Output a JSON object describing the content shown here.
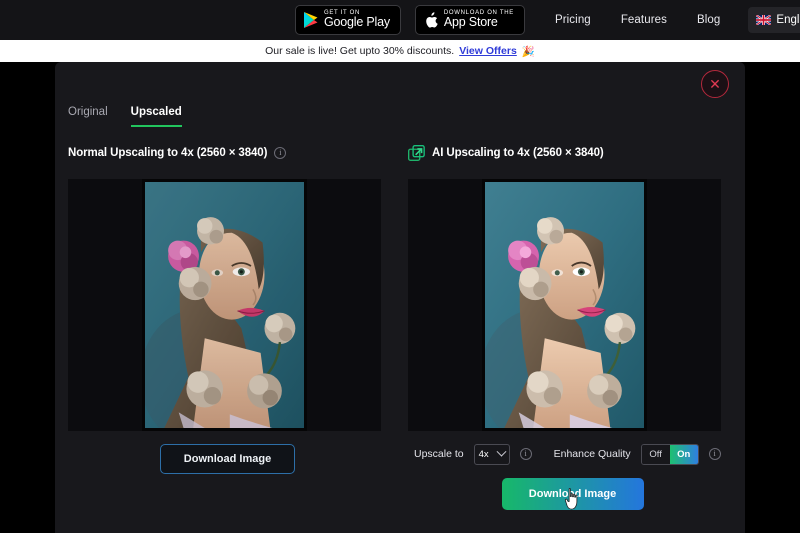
{
  "topnav": {
    "google_play": {
      "sub": "GET IT ON",
      "main": "Google Play",
      "icon": "google-play-icon"
    },
    "app_store": {
      "sub": "Download on the",
      "main": "App Store",
      "icon": "apple-icon"
    },
    "links": [
      "Pricing",
      "Features",
      "Blog"
    ],
    "language": {
      "label": "Engli",
      "flag": "uk-flag-icon"
    }
  },
  "banner": {
    "text": "Our sale is live! Get upto 30% discounts.",
    "link": "View Offers",
    "emoji": "🎉"
  },
  "modal": {
    "close_label": "✕",
    "tabs": [
      {
        "label": "Original",
        "active": false
      },
      {
        "label": "Upscaled",
        "active": true
      }
    ],
    "left": {
      "title": "Normal Upscaling to 4x (2560 × 3840)",
      "info_icon": "info-icon",
      "download_label": "Download Image"
    },
    "right": {
      "title": "AI Upscaling to 4x (2560 × 3840)",
      "ai_icon": "ai-upscale-icon",
      "controls": {
        "upscale_label": "Upscale to",
        "upscale_value": "4x",
        "upscale_info_icon": "info-icon",
        "enhance_label": "Enhance Quality",
        "toggle_off": "Off",
        "toggle_on": "On",
        "toggle_state": "On",
        "enhance_info_icon": "info-icon"
      },
      "download_label": "Download Image"
    }
  },
  "colors": {
    "accent_green": "#22c55e",
    "gradient_start": "#17b869",
    "gradient_end": "#2476dd",
    "close_red": "#e03a52",
    "link_blue": "#2f3bd8",
    "banner_bg": "#ffffff",
    "modal_bg": "#18181c",
    "page_bg": "#000000"
  }
}
